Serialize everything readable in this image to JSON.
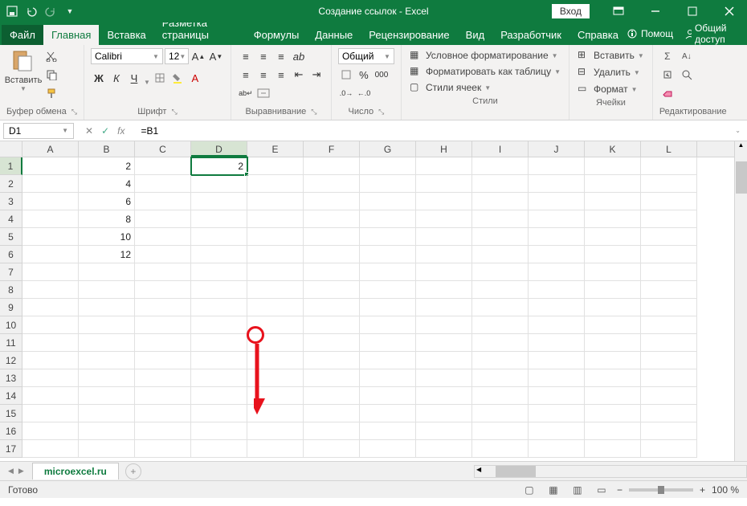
{
  "title": "Создание ссылок  -  Excel",
  "login": "Вход",
  "tabs": {
    "file": "Файл",
    "home": "Главная",
    "insert": "Вставка",
    "layout": "Разметка страницы",
    "formulas": "Формулы",
    "data": "Данные",
    "review": "Рецензирование",
    "view": "Вид",
    "developer": "Разработчик",
    "help": "Справка",
    "tell": "Помощ",
    "share": "Общий доступ"
  },
  "ribbon": {
    "clipboard": {
      "label": "Буфер обмена",
      "paste": "Вставить"
    },
    "font": {
      "label": "Шрифт",
      "name": "Calibri",
      "size": "12"
    },
    "alignment": {
      "label": "Выравнивание"
    },
    "number": {
      "label": "Число",
      "format": "Общий"
    },
    "styles": {
      "label": "Стили",
      "conditional": "Условное форматирование",
      "table": "Форматировать как таблицу",
      "cell": "Стили ячеек"
    },
    "cells": {
      "label": "Ячейки",
      "insert": "Вставить",
      "delete": "Удалить",
      "format": "Формат"
    },
    "editing": {
      "label": "Редактирование"
    }
  },
  "formula_bar": {
    "name_box": "D1",
    "formula": "=B1"
  },
  "columns": [
    "A",
    "B",
    "C",
    "D",
    "E",
    "F",
    "G",
    "H",
    "I",
    "J",
    "K",
    "L"
  ],
  "rows": [
    1,
    2,
    3,
    4,
    5,
    6,
    7,
    8,
    9,
    10,
    11,
    12,
    13,
    14,
    15,
    16,
    17
  ],
  "cells": {
    "B1": "2",
    "B2": "4",
    "B3": "6",
    "B4": "8",
    "B5": "10",
    "B6": "12",
    "D1": "2"
  },
  "active_cell": "D1",
  "sheet": "microexcel.ru",
  "status": "Готово",
  "zoom": "100 %"
}
